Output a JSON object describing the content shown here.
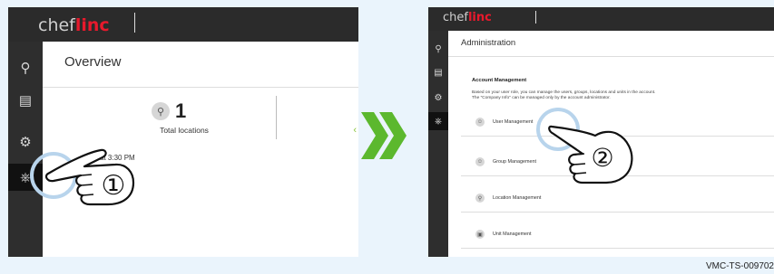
{
  "left_panel": {
    "logo_prefix": "chef",
    "logo_suffix": "linc",
    "sidebar_icons": [
      "location-pin-icon",
      "clipboard-icon",
      "gear-icon",
      "admin-tag-icon"
    ],
    "page_title": "Overview",
    "metric_value": "1",
    "metric_label": "Total locations",
    "time_text": "at 3:30 PM",
    "step_label": "①"
  },
  "arrow_glyph": "»",
  "right_panel": {
    "logo_prefix": "chef",
    "logo_suffix": "linc",
    "sidebar_icons": [
      "location-pin-icon",
      "clipboard-icon",
      "gear-icon",
      "admin-tag-icon"
    ],
    "page_title": "Administration",
    "section_title": "Account Management",
    "description_line1": "Based on your user role, you can manage the users, groups, locations and units in the account.",
    "description_line2": "The \"Company Info\" can be managed only by the account administrator.",
    "menu_items": [
      {
        "label": "User Management",
        "icon": "user-icon"
      },
      {
        "label": "Group Management",
        "icon": "group-icon"
      },
      {
        "label": "Location Management",
        "icon": "location-icon"
      },
      {
        "label": "Unit Management",
        "icon": "unit-icon"
      }
    ],
    "step_label": "②"
  },
  "reference_code": "VMC-TS-009702",
  "colors": {
    "brand_red": "#e8192c",
    "arrow_green": "#5cb82e",
    "highlight_ring": "#b8d4ec"
  }
}
